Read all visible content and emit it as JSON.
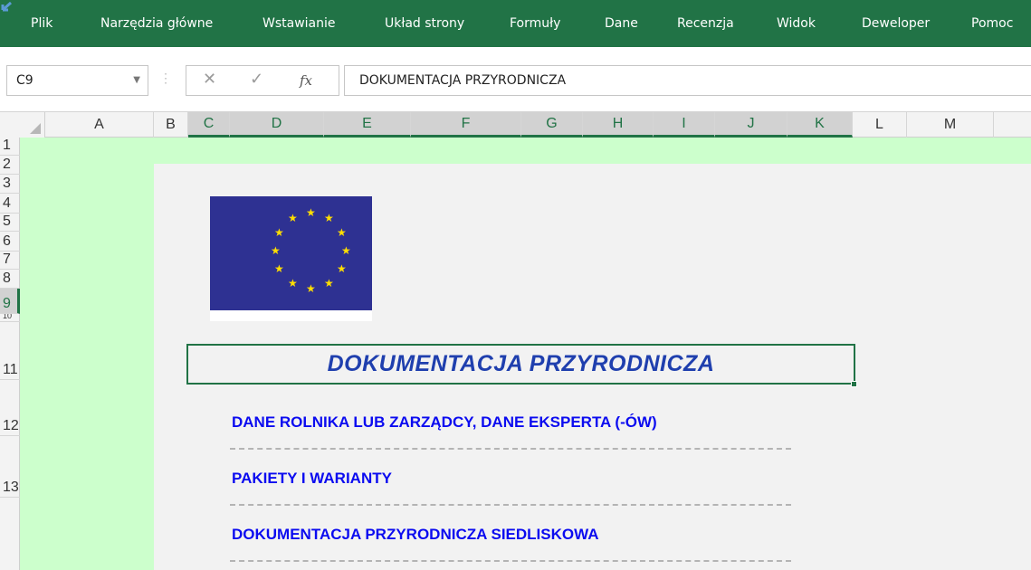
{
  "ribbon": {
    "tabs": [
      "Plik",
      "Narzędzia główne",
      "Wstawianie",
      "Układ strony",
      "Formuły",
      "Dane",
      "Recenzja",
      "Widok",
      "Deweloper",
      "Pomoc"
    ]
  },
  "formula_bar": {
    "name_box": "C9",
    "formula": "DOKUMENTACJA PRZYRODNICZA",
    "icons": [
      "cancel-icon",
      "enter-icon",
      "function-icon"
    ],
    "cancel_glyph": "✕",
    "enter_glyph": "✓",
    "fx_glyph": "fx"
  },
  "columns": [
    "A",
    "B",
    "C",
    "D",
    "E",
    "F",
    "G",
    "H",
    "I",
    "J",
    "K",
    "L",
    "M"
  ],
  "rows": [
    "1",
    "2",
    "3",
    "4",
    "5",
    "6",
    "7",
    "8",
    "9",
    "10",
    "11",
    "12",
    "13"
  ],
  "selected_cell": "C9",
  "colors": {
    "ribbon": "#217346",
    "sheet_background": "#ccffcc",
    "panel": "#f2f2f2",
    "flag_blue": "#2e3192",
    "flag_star": "#ffde00",
    "title": "#1f3fae",
    "link": "#0b0bf0"
  },
  "document": {
    "title": "DOKUMENTACJA PRZYRODNICZA",
    "sections": [
      "DANE ROLNIKA LUB ZARZĄDCY, DANE EKSPERTA (-ÓW)",
      "PAKIETY I WARIANTY",
      "DOKUMENTACJA PRZYRODNICZA SIEDLISKOWA"
    ]
  }
}
